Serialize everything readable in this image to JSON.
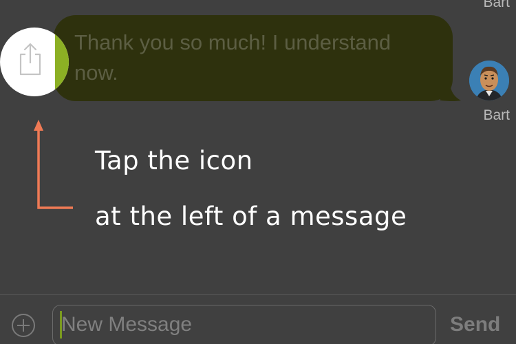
{
  "conversation": {
    "sender_name_top": "Bart",
    "message_text": "Thank you so much! I understand now.",
    "sender_name_bottom": "Bart"
  },
  "tutorial": {
    "line1": "Tap the icon",
    "line2": "at the left of a message"
  },
  "composer": {
    "placeholder": "New Message",
    "send_label": "Send"
  },
  "icons": {
    "share": "share-icon",
    "add": "plus-circle-icon",
    "arrow": "up-arrow-icon",
    "avatar": "avatar-bart"
  },
  "colors": {
    "overlay": "#404040",
    "bubble": "#2e310d",
    "accent_green": "#8cb024",
    "arrow": "#f07a55",
    "avatar_bg": "#3b80b5"
  }
}
